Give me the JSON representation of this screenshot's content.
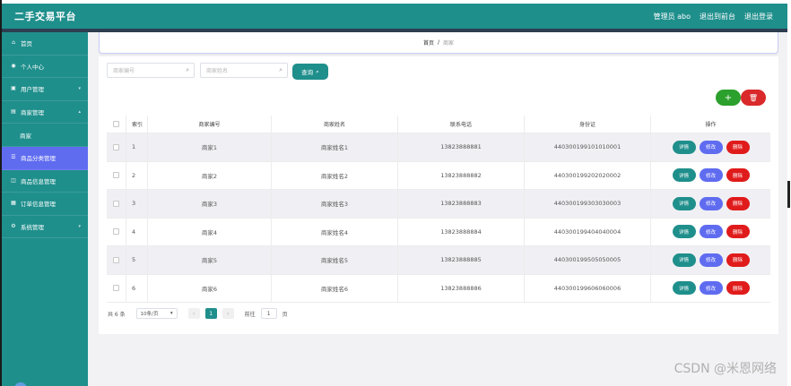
{
  "header": {
    "title": "二手交易平台",
    "user_label": "管理员 abo",
    "back_label": "退出到前台",
    "logout_label": "退出登录"
  },
  "sidebar": {
    "items": [
      {
        "label": "首页",
        "icon": "home-icon"
      },
      {
        "label": "个人中心",
        "icon": "user-icon"
      },
      {
        "label": "用户管理",
        "icon": "users-icon",
        "chevron": true
      },
      {
        "label": "商家管理",
        "icon": "shop-icon",
        "chevron": true
      },
      {
        "label": "商家",
        "sub": true
      },
      {
        "label": "商品分类管理",
        "icon": "category-icon",
        "active": true
      },
      {
        "label": "商品信息管理",
        "icon": "goods-icon"
      },
      {
        "label": "订单信息管理",
        "icon": "order-icon"
      },
      {
        "label": "系统管理",
        "icon": "settings-icon",
        "chevron": true
      }
    ]
  },
  "breadcrumb": {
    "home": "首页",
    "separator": "/",
    "current": "商家"
  },
  "search": {
    "merchant_no_placeholder": "商家编号",
    "merchant_name_placeholder": "商家姓名",
    "query_label": "查询"
  },
  "actions": {
    "add_symbol": "+",
    "delete_symbol": "🗑"
  },
  "table": {
    "headers": [
      "索引",
      "商家编号",
      "商家姓名",
      "联系电话",
      "身份证",
      "操作"
    ],
    "rows": [
      {
        "index": "1",
        "merchant_no": "商家1",
        "merchant_name": "商家姓名1",
        "phone": "13823888881",
        "id_card": "440300199101010001"
      },
      {
        "index": "2",
        "merchant_no": "商家2",
        "merchant_name": "商家姓名2",
        "phone": "13823888882",
        "id_card": "440300199202020002"
      },
      {
        "index": "3",
        "merchant_no": "商家3",
        "merchant_name": "商家姓名3",
        "phone": "13823888883",
        "id_card": "440300199303030003"
      },
      {
        "index": "4",
        "merchant_no": "商家4",
        "merchant_name": "商家姓名4",
        "phone": "13823888884",
        "id_card": "440300199404040004"
      },
      {
        "index": "5",
        "merchant_no": "商家5",
        "merchant_name": "商家姓名5",
        "phone": "13823888885",
        "id_card": "440300199505050005"
      },
      {
        "index": "6",
        "merchant_no": "商家6",
        "merchant_name": "商家姓名6",
        "phone": "13823888886",
        "id_card": "440300199606060006"
      }
    ],
    "row_buttons": {
      "detail": "详情",
      "edit": "修改",
      "remove": "删除"
    }
  },
  "pagination": {
    "total_label": "共 6 条",
    "page_size": "10条/页",
    "current_page": "1",
    "goto_prefix": "前往",
    "goto_value": "1",
    "goto_suffix": "页"
  },
  "watermark": "CSDN @米恩网络",
  "colors": {
    "teal": "#1f8f8c",
    "indigo": "#5f6cf0",
    "red": "#e01b1b",
    "green": "#2ca02c"
  }
}
